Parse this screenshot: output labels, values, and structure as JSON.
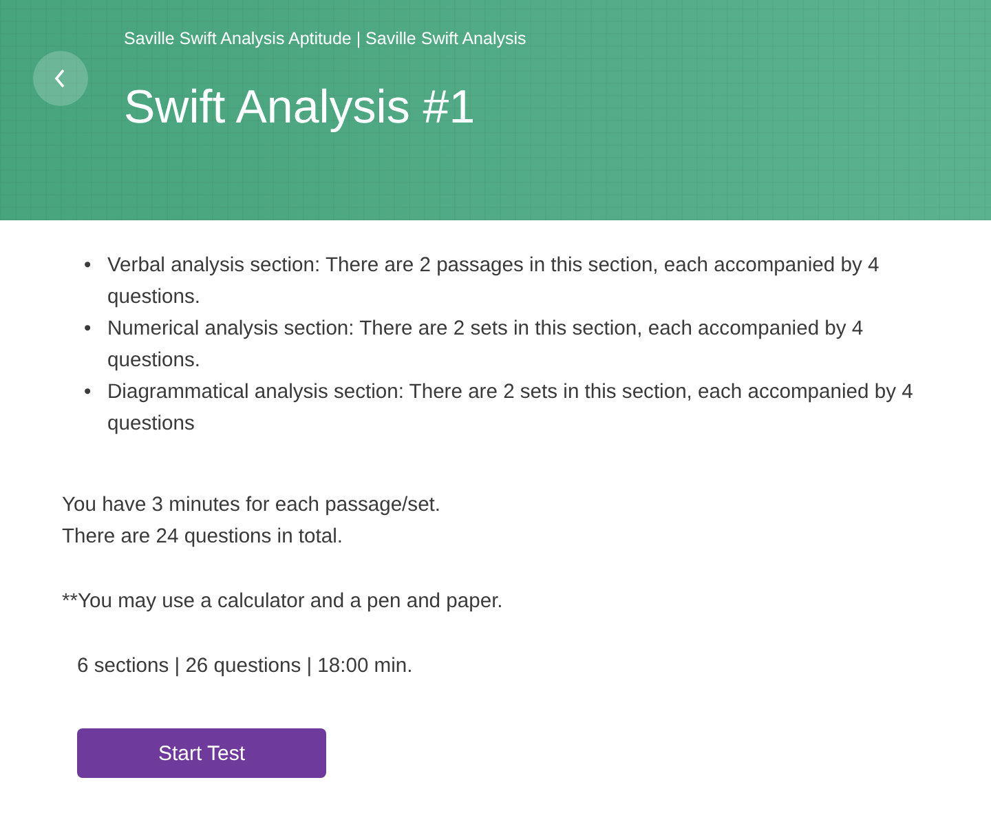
{
  "header": {
    "breadcrumb": "Saville Swift Analysis Aptitude | Saville Swift Analysis",
    "title": "Swift Analysis #1"
  },
  "sections": [
    {
      "marker": "•",
      "text": "Verbal analysis section: There are 2 passages in this section, each accompanied by 4 questions."
    },
    {
      "marker": "•",
      "text": "Numerical analysis section: There are 2 sets in this section, each accompanied by 4 questions."
    },
    {
      "marker": "•",
      "text": "Diagrammatical analysis section: There are 2 sets in this section, each accompanied by 4 questions"
    }
  ],
  "notes": [
    "You have 3 minutes for each passage/set.",
    "There are 24 questions in total."
  ],
  "tip": "**You may use a calculator and a pen and paper.",
  "summary": "6 sections | 26 questions | 18:00 min.",
  "start_button": "Start Test"
}
